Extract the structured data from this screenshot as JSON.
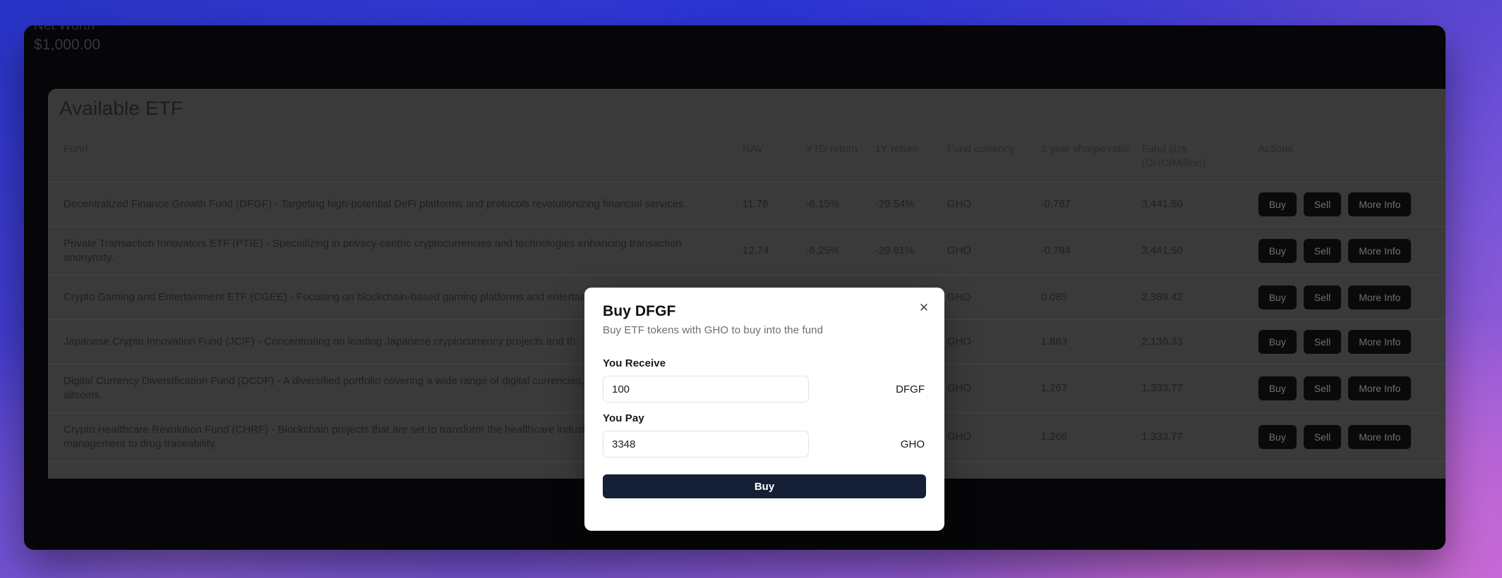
{
  "account": {
    "net_worth_label": "Net Worth",
    "net_worth_value": "$1,000.00"
  },
  "etf_panel": {
    "title": "Available ETF",
    "columns": {
      "fund": "Fund",
      "nav": "NAV",
      "ytd_return": "YTD return",
      "one_year_return": "1Y return",
      "fund_currency": "Fund currency",
      "sharpe_ratio": "1 year sharpe ratio",
      "fund_size": "Fund size (GHO/Million)",
      "actions": "Actions"
    },
    "actions": {
      "buy": "Buy",
      "sell": "Sell",
      "more_info": "More Info"
    },
    "rows": [
      {
        "fund": "Decentralized Finance Growth Fund (DFGF) - Targeting high-potential DeFi platforms and protocols revolutionizing financial services.",
        "nav": "11.76",
        "ytd_return": "-6.15%",
        "one_year_return": "-29.54%",
        "fund_currency": "GHO",
        "sharpe_ratio": "-0.787",
        "fund_size": "3,441.50"
      },
      {
        "fund": "Private Transaction Innovators ETF (PTIE) - Specializing in privacy-centric cryptocurrencies and technologies enhancing transaction anonymity.",
        "nav": "12.74",
        "ytd_return": "-6.25%",
        "one_year_return": "-29.61%",
        "fund_currency": "GHO",
        "sharpe_ratio": "-0.784",
        "fund_size": "3,441.50"
      },
      {
        "fund": "Crypto Gaming and Entertainment ETF (CGEE) - Focusing on blockchain-based gaming platforms and entertainment.",
        "nav": "",
        "ytd_return": "",
        "one_year_return": "",
        "fund_currency": "GHO",
        "sharpe_ratio": "0.085",
        "fund_size": "2,389.42"
      },
      {
        "fund": "Japanese Crypto Innovation Fund (JCIF) - Concentrating on leading Japanese cryptocurrency projects and th",
        "nav": "",
        "ytd_return": "",
        "one_year_return": "",
        "fund_currency": "GHO",
        "sharpe_ratio": "1.863",
        "fund_size": "2,136.33"
      },
      {
        "fund": "Digital Currency Diversification Fund (DCDF) - A diversified portfolio covering a wide range of digital currencies, from major coins to emerging altcoins.",
        "nav": "",
        "ytd_return": "",
        "one_year_return": "",
        "fund_currency": "GHO",
        "sharpe_ratio": "1.267",
        "fund_size": "1,333.77"
      },
      {
        "fund": "Crypto Healthcare Revolution Fund (CHRF) - Blockchain projects that are set to transform the healthcare industry, from patient data management to drug traceability.",
        "nav": "",
        "ytd_return": "",
        "one_year_return": "",
        "fund_currency": "GHO",
        "sharpe_ratio": "1.268",
        "fund_size": "1,333.77"
      }
    ]
  },
  "buy_modal": {
    "title": "Buy DFGF",
    "subtitle": "Buy ETF tokens with GHO to buy into the fund",
    "close_icon": "close-icon",
    "receive_label": "You Receive",
    "receive_value": "100",
    "receive_symbol": "DFGF",
    "pay_label": "You Pay",
    "pay_value": "3348",
    "pay_symbol": "GHO",
    "submit_label": "Buy"
  },
  "colors": {
    "negative": "#7b1e22",
    "modal_cta": "#152036",
    "card_bg": "#3a3a3a",
    "window_bg": "#060608"
  }
}
